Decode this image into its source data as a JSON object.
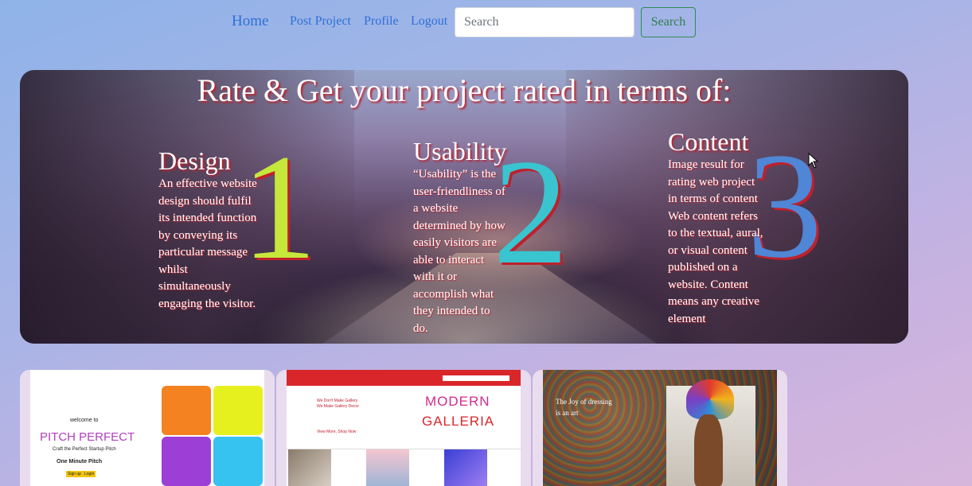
{
  "nav": {
    "brand": "Home",
    "links": [
      "Post Project",
      "Profile",
      "Logout"
    ],
    "search_placeholder": "Search",
    "search_button": "Search"
  },
  "hero": {
    "title": "Rate & Get your project rated in terms of:",
    "criteria": [
      {
        "heading": "Design",
        "number": "1",
        "text": "An effective website design should fulfil its intended function by conveying its particular message whilst simultaneously engaging the visitor."
      },
      {
        "heading": "Usability",
        "number": "2",
        "text": "“Usability” is the user-friendliness of a website determined by how easily visitors are able to interact with it or accomplish what they intended to do."
      },
      {
        "heading": "Content",
        "number": "3",
        "text": "Image result for rating web project in terms of content Web content refers to the textual, aural, or visual content published on a website. Content means any creative element"
      }
    ],
    "number_colors": [
      "#c6e83a",
      "#39c4cf",
      "#4f86d6"
    ]
  },
  "projects": [
    {
      "welcome": "welcome to",
      "title": "PITCH PERFECT",
      "tagline": "Craft the Perfect Startup Pitch",
      "subtitle": "One Minute Pitch",
      "buttons": [
        "Sign up",
        "Login"
      ]
    },
    {
      "lines": [
        "We Don't Make Gallery",
        "We Make Gallery Decor"
      ],
      "link": "View More, Shop Now",
      "title_line1": "MODERN",
      "title_line2": "GALLERIA"
    },
    {
      "title_line1": "The Joy of dressing",
      "title_line2": "is an art"
    }
  ]
}
